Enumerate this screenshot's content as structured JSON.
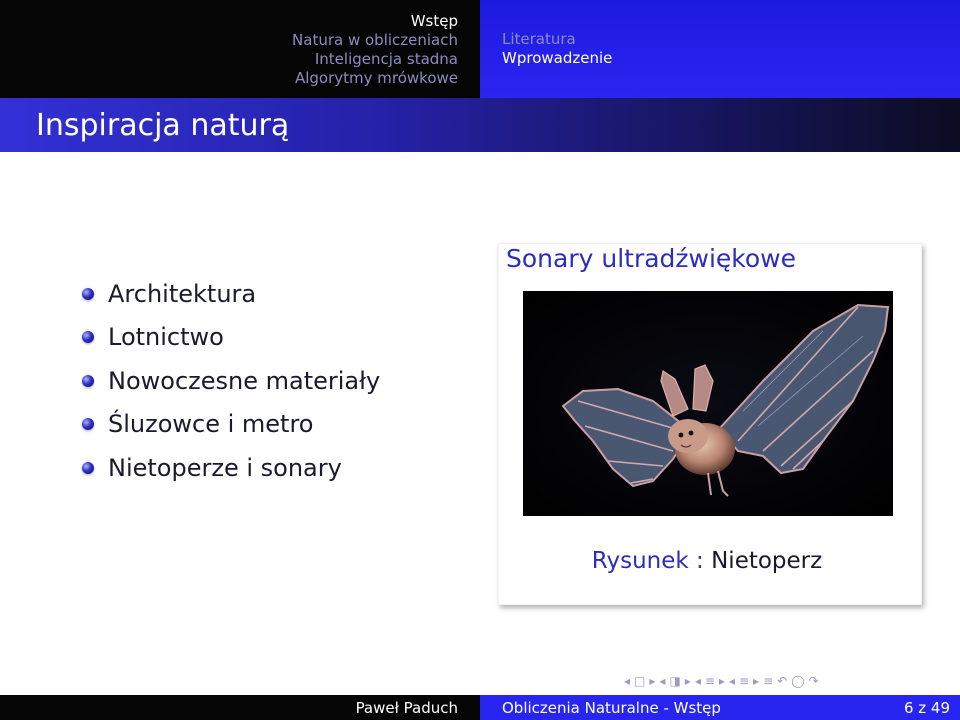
{
  "nav": {
    "sections_left": [
      "Wstęp",
      "Natura w obliczeniach",
      "Inteligencja stadna",
      "Algorytmy mrówkowe"
    ],
    "sections_right": [
      "Literatura",
      "Wprowadzenie"
    ],
    "active_left": "Wstęp",
    "active_right": "Wprowadzenie"
  },
  "frame": {
    "title": "Inspiracja naturą"
  },
  "bullets": [
    "Architektura",
    "Lotnictwo",
    "Nowoczesne materiały",
    "Śluzowce i metro",
    "Nietoperze i sonary"
  ],
  "figure": {
    "heading": "Sonary ultradźwiękowe",
    "image_subject": "bat",
    "caption_label": "Rysunek :",
    "caption_text": "Nietoperz"
  },
  "nav_symbols": [
    "◂",
    "□",
    "▸",
    "◂",
    "◨",
    "▸",
    "◂",
    "≡",
    "▸",
    "◂",
    "≡",
    "▸",
    "≡",
    "↶",
    "◯",
    "↷"
  ],
  "footer": {
    "author": "Paweł Paduch",
    "title": "Obliczenia Naturalne - Wstęp",
    "page": "6 z 49"
  },
  "colors": {
    "accent_blue": "#2825f0",
    "header_black": "#050505",
    "heading_blue": "#2c2cc0"
  }
}
